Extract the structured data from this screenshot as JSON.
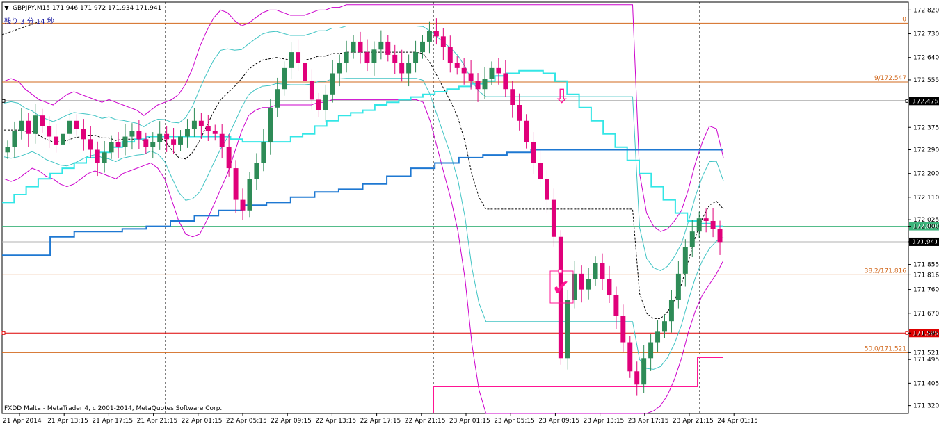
{
  "window": {
    "symbol_header": "GBPJPY,M15  171.946 171.972 171.934 171.941",
    "countdown": "残り 3 分 14 秒",
    "copyright": "FXDD Malta - MetaTrader 4, c 2001-2014, MetaQuotes Software Corp."
  },
  "colors": {
    "bull": "#2e8b57",
    "bear": "#e0007a",
    "bb_outer": "#cc00cc",
    "bb_inner": "#40c4c4",
    "ma_mid": "#000000",
    "cyan_line": "#33e6e6",
    "blue_line": "#1e78d2",
    "fib": "#d2691e",
    "support_red": "#dd0000",
    "round_green": "#3cb37a",
    "price_grey": "#b0b0b0",
    "magenta_step": "#ff1493",
    "black_line": "#000000"
  },
  "chart_data": {
    "type": "candlestick",
    "title": "GBPJPY,M15",
    "ylim": [
      171.29,
      172.85
    ],
    "y_ticks": [
      "172.820",
      "172.730",
      "172.640",
      "172.555",
      "172.475",
      "172.375",
      "172.290",
      "172.200",
      "172.110",
      "172.025",
      "172.000",
      "171.941",
      "171.855",
      "171.816",
      "171.760",
      "171.670",
      "171.595",
      "171.521",
      "171.495",
      "171.405",
      "171.320"
    ],
    "x_labels": [
      "21 Apr 2014",
      "21 Apr 13:15",
      "21 Apr 17:15",
      "21 Apr 21:15",
      "22 Apr 01:15",
      "22 Apr 05:15",
      "22 Apr 09:15",
      "22 Apr 13:15",
      "22 Apr 17:15",
      "22 Apr 21:15",
      "23 Apr 01:15",
      "23 Apr 05:15",
      "23 Apr 09:15",
      "23 Apr 13:15",
      "23 Apr 17:15",
      "23 Apr 21:15",
      "24 Apr 01:15"
    ],
    "horizontal_levels": [
      {
        "name": "fib-0",
        "value": 172.77,
        "label": "0",
        "kind": "fib"
      },
      {
        "name": "fib-23.6",
        "value": 172.547,
        "label": "9/172.547",
        "kind": "fib"
      },
      {
        "name": "black-level",
        "value": 172.475,
        "label": "172.475",
        "kind": "black"
      },
      {
        "name": "round-level",
        "value": 172.0,
        "label": "172.000",
        "kind": "green"
      },
      {
        "name": "current-price",
        "value": 171.941,
        "label": "171.941",
        "kind": "price"
      },
      {
        "name": "fib-38.2",
        "value": 171.816,
        "label": "38.2/171.816",
        "kind": "fib"
      },
      {
        "name": "support-level",
        "value": 171.595,
        "label": "171.595",
        "kind": "red"
      },
      {
        "name": "fib-50",
        "value": 171.521,
        "label": "50.0/171.521",
        "kind": "fib"
      }
    ],
    "close_path": [
      172.3,
      172.36,
      172.4,
      172.35,
      172.42,
      172.38,
      172.34,
      172.31,
      172.35,
      172.4,
      172.37,
      172.33,
      172.29,
      172.24,
      172.28,
      172.32,
      172.3,
      172.34,
      172.36,
      172.33,
      172.3,
      172.32,
      172.35,
      172.33,
      172.31,
      172.34,
      172.37,
      172.4,
      172.38,
      172.36,
      172.35,
      172.3,
      172.22,
      172.1,
      172.06,
      172.18,
      172.24,
      172.32,
      172.45,
      172.52,
      172.6,
      172.66,
      172.62,
      172.55,
      172.48,
      172.44,
      172.5,
      172.58,
      172.62,
      172.66,
      172.7,
      172.66,
      172.62,
      172.67,
      172.7,
      172.65,
      172.62,
      172.58,
      172.62,
      172.66,
      172.7,
      172.74,
      172.72,
      172.68,
      172.62,
      172.6,
      172.58,
      172.55,
      172.52,
      172.56,
      172.6,
      172.58,
      172.52,
      172.46,
      172.4,
      172.32,
      172.24,
      172.18,
      172.1,
      171.96,
      171.5,
      171.72,
      171.82,
      171.76,
      171.8,
      171.86,
      171.8,
      171.74,
      171.66,
      171.56,
      171.45,
      171.4,
      171.5,
      171.56,
      171.6,
      171.64,
      171.72,
      171.82,
      171.92,
      171.98,
      172.03,
      172.02,
      171.99,
      171.94
    ],
    "bb_upper_path": [
      172.55,
      172.56,
      172.55,
      172.52,
      172.5,
      172.48,
      172.47,
      172.46,
      172.48,
      172.5,
      172.51,
      172.5,
      172.49,
      172.48,
      172.47,
      172.48,
      172.47,
      172.46,
      172.45,
      172.44,
      172.42,
      172.44,
      172.46,
      172.47,
      172.48,
      172.5,
      172.54,
      172.6,
      172.68,
      172.74,
      172.79,
      172.82,
      172.81,
      172.78,
      172.76,
      172.77,
      172.79,
      172.81,
      172.82,
      172.82,
      172.81,
      172.8,
      172.8,
      172.8,
      172.81,
      172.82,
      172.82,
      172.83,
      172.83,
      172.84,
      172.84,
      172.84,
      172.84,
      172.84,
      172.84,
      172.84,
      172.84,
      172.84,
      172.84,
      172.84,
      172.84,
      172.84,
      172.84,
      172.84,
      172.84,
      172.84,
      172.84,
      172.84,
      172.84,
      172.84,
      172.84,
      172.84,
      172.84,
      172.84,
      172.84,
      172.84,
      172.84,
      172.84,
      172.84,
      172.84,
      172.84,
      172.84,
      172.84,
      172.84,
      172.84,
      172.84,
      172.84,
      172.84,
      172.84,
      172.84,
      172.84,
      172.2,
      172.05,
      172.0,
      171.98,
      171.99,
      172.02,
      172.06,
      172.14,
      172.24,
      172.32,
      172.38,
      172.37,
      172.26
    ],
    "bb_lower_path": [
      172.18,
      172.17,
      172.18,
      172.2,
      172.22,
      172.21,
      172.19,
      172.18,
      172.16,
      172.15,
      172.16,
      172.18,
      172.2,
      172.21,
      172.2,
      172.19,
      172.18,
      172.2,
      172.21,
      172.22,
      172.23,
      172.24,
      172.22,
      172.18,
      172.1,
      172.02,
      171.97,
      171.96,
      171.97,
      172.02,
      172.08,
      172.14,
      172.2,
      172.28,
      172.36,
      172.42,
      172.44,
      172.45,
      172.45,
      172.46,
      172.46,
      172.46,
      172.46,
      172.46,
      172.46,
      172.47,
      172.47,
      172.48,
      172.48,
      172.48,
      172.48,
      172.48,
      172.48,
      172.48,
      172.48,
      172.48,
      172.48,
      172.48,
      172.48,
      172.48,
      172.47,
      172.4,
      172.3,
      172.2,
      172.1,
      171.98,
      171.8,
      171.55,
      171.38,
      171.29,
      171.29,
      171.29,
      171.29,
      171.29,
      171.29,
      171.29,
      171.29,
      171.29,
      171.29,
      171.29,
      171.29,
      171.29,
      171.29,
      171.29,
      171.29,
      171.29,
      171.29,
      171.29,
      171.29,
      171.29,
      171.29,
      171.29,
      171.29,
      171.3,
      171.32,
      171.36,
      171.42,
      171.5,
      171.6,
      171.68,
      171.74,
      171.78,
      171.82,
      171.87
    ],
    "cyan_line_path": [
      172.09,
      172.12,
      172.15,
      172.18,
      172.2,
      172.22,
      172.24,
      172.26,
      172.28,
      172.3,
      172.32,
      172.33,
      172.34,
      172.34,
      172.34,
      172.34,
      172.34,
      172.34,
      172.34,
      172.33,
      172.32,
      172.32,
      172.32,
      172.32,
      172.34,
      172.35,
      172.38,
      172.4,
      172.42,
      172.43,
      172.44,
      172.46,
      172.47,
      172.48,
      172.49,
      172.5,
      172.51,
      172.52,
      172.53,
      172.54,
      172.55,
      172.57,
      172.58,
      172.59,
      172.59,
      172.58,
      172.55,
      172.5,
      172.45,
      172.4,
      172.35,
      172.3,
      172.25,
      172.2,
      172.15,
      172.1,
      172.05,
      172.02,
      172.01,
      172.0
    ],
    "blue_line_path": [
      171.89,
      171.89,
      171.96,
      171.98,
      171.98,
      171.99,
      172.0,
      172.02,
      172.04,
      172.06,
      172.08,
      172.09,
      172.11,
      172.13,
      172.14,
      172.16,
      172.19,
      172.22,
      172.24,
      172.26,
      172.27,
      172.28,
      172.29,
      172.29,
      172.29,
      172.29,
      172.29,
      172.29,
      172.29,
      172.29
    ]
  },
  "annotations": {
    "check_mark": "✔",
    "down_arrow": "⇩"
  }
}
